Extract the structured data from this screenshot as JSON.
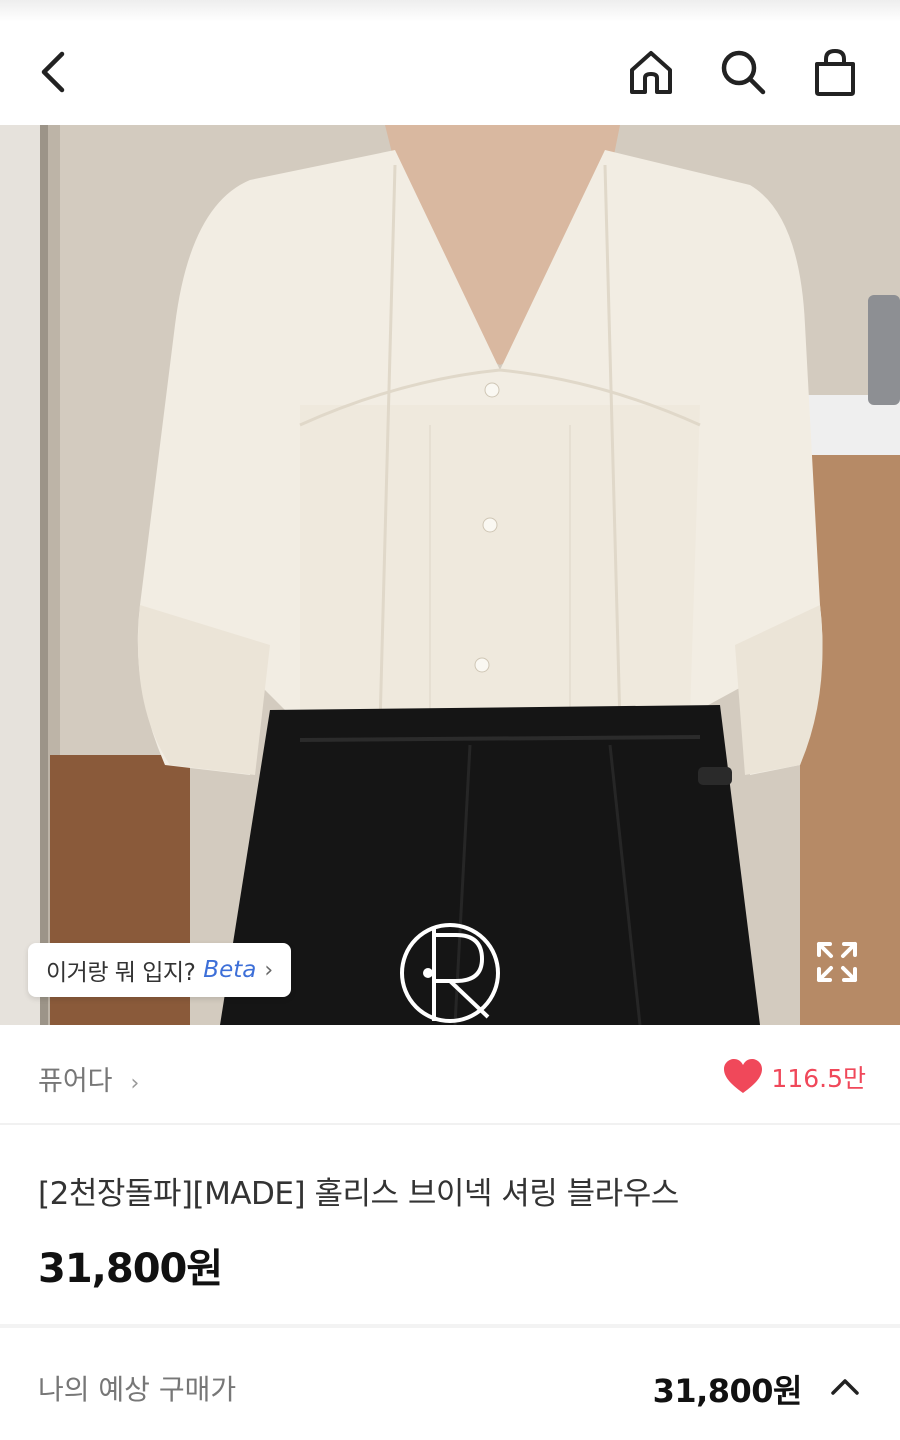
{
  "nav": {
    "back_icon": "chevron-left-icon",
    "home_icon": "home-icon",
    "search_icon": "search-icon",
    "cart_icon": "shopping-bag-icon"
  },
  "hero": {
    "outfit_chip": {
      "label": "이거랑 뭐 입지?",
      "beta": "Beta",
      "arrow": "›"
    },
    "expand_icon": "expand-icon"
  },
  "store": {
    "name": "퓨어다",
    "chevron": "›",
    "likes": "116.5만",
    "like_color": "#f0485a"
  },
  "product": {
    "title": "[2천장돌파][MADE] 홀리스 브이넥 셔링 블라우스",
    "price": "31,800원"
  },
  "expected": {
    "label": "나의 예상 구매가",
    "value": "31,800원"
  }
}
